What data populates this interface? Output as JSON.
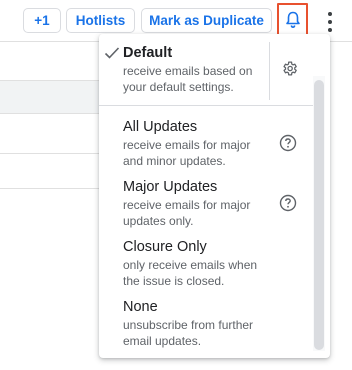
{
  "toolbar": {
    "plus_one_label": "+1",
    "hotlists_label": "Hotlists",
    "mark_duplicate_label": "Mark as Duplicate",
    "bell_icon": "bell-icon",
    "more_icon": "more-vert-icon",
    "highlight_color": "#e8512f",
    "accent_color": "#1a73e8"
  },
  "notification_menu": {
    "items": [
      {
        "title": "Default",
        "description": "receive emails based on your default settings.",
        "selected": true,
        "trailing_icon": "gear-icon"
      },
      {
        "title": "All Updates",
        "description": "receive emails for major and minor updates.",
        "selected": false,
        "trailing_icon": "help-icon"
      },
      {
        "title": "Major Updates",
        "description": "receive emails for major updates only.",
        "selected": false,
        "trailing_icon": "help-icon"
      },
      {
        "title": "Closure Only",
        "description": "only receive emails when the issue is closed.",
        "selected": false,
        "trailing_icon": ""
      },
      {
        "title": "None",
        "description": "unsubscribe from further email updates.",
        "selected": false,
        "trailing_icon": ""
      }
    ]
  }
}
